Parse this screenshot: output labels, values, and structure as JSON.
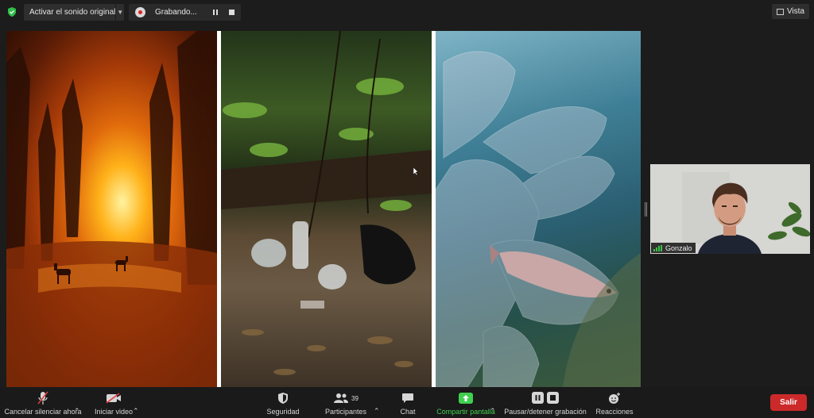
{
  "topbar": {
    "audio_button_label": "Activar el sonido original",
    "recording_label": "Grabando...",
    "view_label": "Vista"
  },
  "shared_screen": {
    "panels": [
      "forest-fire-photo",
      "litter-in-forest-photo",
      "plastic-glove-underwater-photo"
    ]
  },
  "participant": {
    "name": "Gonzalo"
  },
  "toolbar": {
    "mute_label": "Cancelar silenciar ahora",
    "video_label": "Iniciar video",
    "security_label": "Seguridad",
    "participants_label": "Participantes",
    "participants_count": "39",
    "chat_label": "Chat",
    "share_label": "Compartir pantalla",
    "record_label": "Pausar/detener grabación",
    "reactions_label": "Reacciones",
    "leave_label": "Salir"
  },
  "colors": {
    "accent_green": "#3fd04f",
    "leave_red": "#cc2a2a",
    "record_red": "#e02424"
  }
}
